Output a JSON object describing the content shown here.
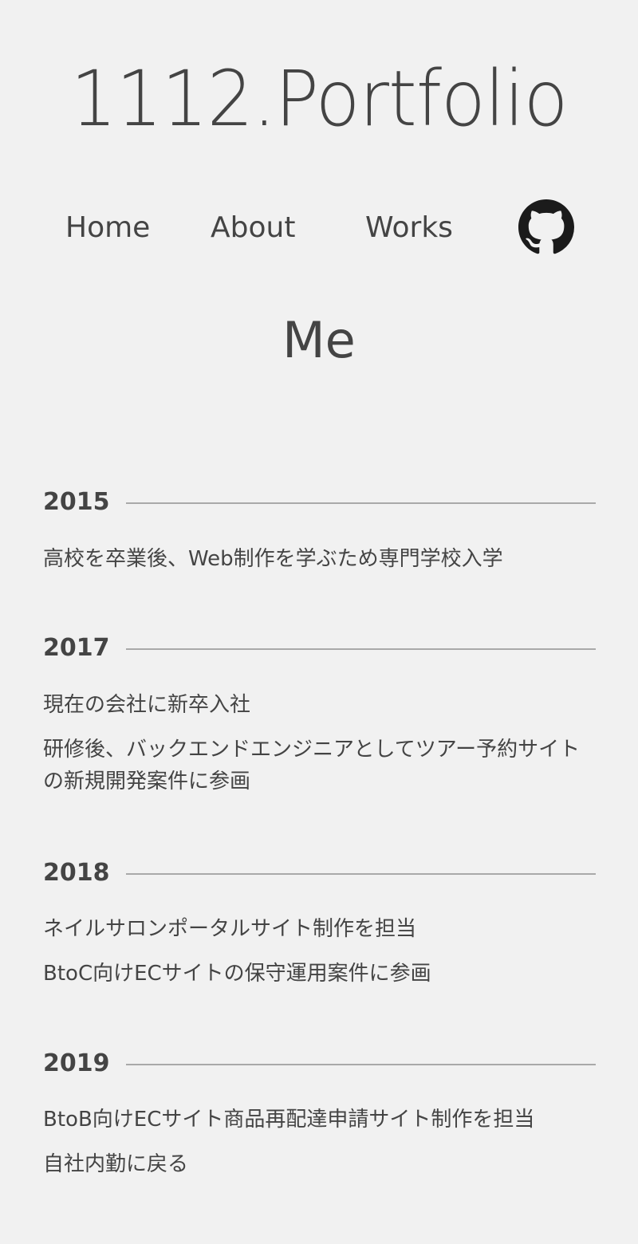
{
  "header": {
    "site_title": "1112.Portfolio"
  },
  "nav": {
    "items": [
      {
        "label": "Home"
      },
      {
        "label": "About"
      },
      {
        "label": "Works"
      }
    ],
    "github_icon": "github-icon"
  },
  "main": {
    "section_title": "Me",
    "timeline": [
      {
        "year": "2015",
        "events": [
          "高校を卒業後、Web制作を学ぶため専門学校入学"
        ]
      },
      {
        "year": "2017",
        "events": [
          "現在の会社に新卒入社",
          "研修後、バックエンドエンジニアとしてツアー予約サイトの新規開発案件に参画"
        ]
      },
      {
        "year": "2018",
        "events": [
          "ネイルサロンポータルサイト制作を担当",
          "BtoC向けECサイトの保守運用案件に参画"
        ]
      },
      {
        "year": "2019",
        "events": [
          "BtoB向けECサイト商品再配達申請サイト制作を担当",
          "自社内勤に戻る"
        ]
      }
    ]
  },
  "colors": {
    "background": "#f1f1f1",
    "text": "#444444",
    "rule": "#a9a9a9"
  }
}
